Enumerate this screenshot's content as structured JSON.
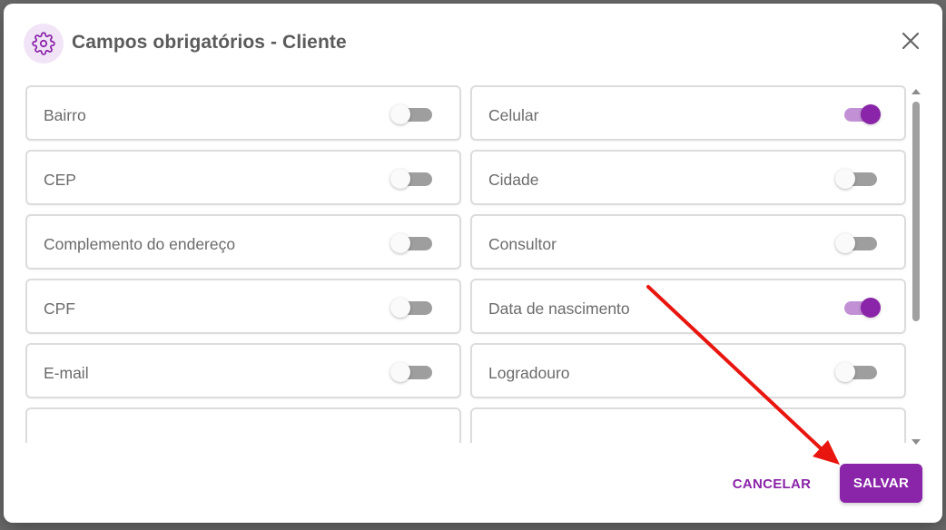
{
  "dialog": {
    "title": "Campos obrigatórios - Cliente",
    "header_icon": "gear-icon",
    "close_icon": "close-icon"
  },
  "fields": [
    {
      "label": "Bairro",
      "enabled": false
    },
    {
      "label": "Celular",
      "enabled": true
    },
    {
      "label": "CEP",
      "enabled": false
    },
    {
      "label": "Cidade",
      "enabled": false
    },
    {
      "label": "Complemento do endereço",
      "enabled": false
    },
    {
      "label": "Consultor",
      "enabled": false
    },
    {
      "label": "CPF",
      "enabled": false
    },
    {
      "label": "Data de nascimento",
      "enabled": true
    },
    {
      "label": "E-mail",
      "enabled": false
    },
    {
      "label": "Logradouro",
      "enabled": false
    },
    {
      "label": "",
      "enabled": false
    },
    {
      "label": "",
      "enabled": false
    }
  ],
  "footer": {
    "cancel_label": "CANCELAR",
    "save_label": "SALVAR"
  },
  "colors": {
    "accent": "#8a24a8",
    "accent_light": "#f1e4f7",
    "annotation_arrow": "#e8160f"
  }
}
